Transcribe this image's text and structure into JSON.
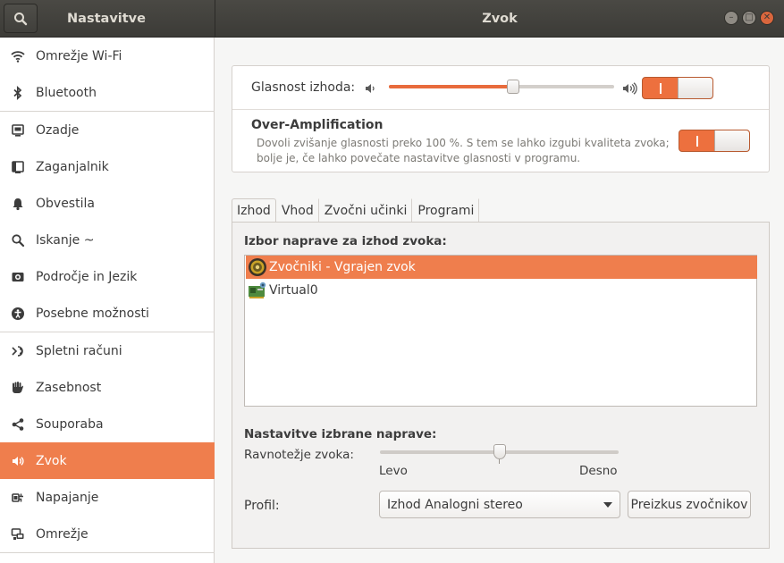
{
  "header": {
    "left_title": "Nastavitve",
    "title": "Zvok",
    "search_icon": "search-icon",
    "window_buttons": [
      "minimize",
      "maximize",
      "close"
    ]
  },
  "sidebar": {
    "items": [
      {
        "label": "Omrežje Wi-Fi",
        "icon": "wifi-icon"
      },
      {
        "label": "Bluetooth",
        "icon": "bluetooth-icon"
      },
      {
        "label": "Ozadje",
        "icon": "background-icon"
      },
      {
        "label": "Zaganjalnik",
        "icon": "dock-icon"
      },
      {
        "label": "Obvestila",
        "icon": "bell-icon"
      },
      {
        "label": "Iskanje ~",
        "icon": "search-icon"
      },
      {
        "label": "Področje in Jezik",
        "icon": "region-icon"
      },
      {
        "label": "Posebne možnosti",
        "icon": "accessibility-icon"
      },
      {
        "label": "Spletni računi",
        "icon": "online-accounts-icon"
      },
      {
        "label": "Zasebnost",
        "icon": "hand-icon"
      },
      {
        "label": "Souporaba",
        "icon": "share-icon"
      },
      {
        "label": "Zvok",
        "icon": "speaker-icon",
        "active": true
      },
      {
        "label": "Napajanje",
        "icon": "power-icon"
      },
      {
        "label": "Omrežje",
        "icon": "network-icon"
      }
    ]
  },
  "output_volume": {
    "label": "Glasnost izhoda:",
    "level": 0.55,
    "switch_on": true
  },
  "over_amplification": {
    "title": "Over-Amplification",
    "description": "Dovoli zvišanje glasnosti preko 100 %. S tem se lahko izgubi kvaliteta zvoka; bolje je, če lahko povečate nastavitve glasnosti v programu.",
    "switch_on": true
  },
  "tabs": [
    {
      "label": "Izhod",
      "active": true
    },
    {
      "label": "Vhod"
    },
    {
      "label": "Zvočni učinki"
    },
    {
      "label": "Programi"
    }
  ],
  "output_panel": {
    "device_section_title": "Izbor naprave za izhod zvoka:",
    "devices": [
      {
        "label": "Zvočniki - Vgrajen zvok",
        "icon": "speaker-device-icon",
        "selected": true
      },
      {
        "label": "Virtual0",
        "icon": "sound-card-icon"
      }
    ],
    "settings_title": "Nastavitve izbrane naprave:",
    "balance_label": "Ravnotežje zvoka:",
    "balance_left": "Levo",
    "balance_right": "Desno",
    "balance_value": 0.5,
    "profile_label": "Profil:",
    "profile_value": "Izhod Analogni stereo",
    "test_button": "Preizkus zvočnikov"
  },
  "colors": {
    "accent": "#ef7e4d",
    "header": "#3c3b37"
  }
}
